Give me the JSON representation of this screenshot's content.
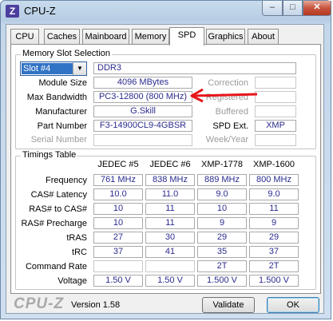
{
  "window": {
    "title": "CPU-Z",
    "icon_text": "Z",
    "min": "–",
    "max": "□",
    "close": "✕"
  },
  "tabs": [
    "CPU",
    "Caches",
    "Mainboard",
    "Memory",
    "SPD",
    "Graphics",
    "About"
  ],
  "active_tab": "SPD",
  "memory_slot": {
    "group_title": "Memory Slot Selection",
    "slot": "Slot #4",
    "type": "DDR3",
    "labels": {
      "module_size": "Module Size",
      "max_bandwidth": "Max Bandwidth",
      "manufacturer": "Manufacturer",
      "part_number": "Part Number",
      "serial_number": "Serial Number",
      "correction": "Correction",
      "registered": "Registered",
      "buffered": "Buffered",
      "spd_ext": "SPD Ext.",
      "week_year": "Week/Year"
    },
    "values": {
      "module_size": "4096 MBytes",
      "max_bandwidth": "PC3-12800 (800 MHz)",
      "manufacturer": "G.Skill",
      "part_number": "F3-14900CL9-4GBSR",
      "serial_number": "",
      "correction": "",
      "registered": "",
      "buffered": "",
      "spd_ext": "XMP",
      "week_year": ""
    }
  },
  "timings": {
    "group_title": "Timings Table",
    "columns": [
      "JEDEC #5",
      "JEDEC #6",
      "XMP-1778",
      "XMP-1600"
    ],
    "rows": [
      {
        "label": "Frequency",
        "values": [
          "761 MHz",
          "838 MHz",
          "889 MHz",
          "800 MHz"
        ]
      },
      {
        "label": "CAS# Latency",
        "values": [
          "10.0",
          "11.0",
          "9.0",
          "9.0"
        ]
      },
      {
        "label": "RAS# to CAS#",
        "values": [
          "10",
          "11",
          "10",
          "11"
        ]
      },
      {
        "label": "RAS# Precharge",
        "values": [
          "10",
          "11",
          "9",
          "9"
        ]
      },
      {
        "label": "tRAS",
        "values": [
          "27",
          "30",
          "29",
          "29"
        ]
      },
      {
        "label": "tRC",
        "values": [
          "37",
          "41",
          "35",
          "37"
        ]
      },
      {
        "label": "Command Rate",
        "values": [
          "",
          "",
          "2T",
          "2T"
        ]
      },
      {
        "label": "Voltage",
        "values": [
          "1.50 V",
          "1.50 V",
          "1.500 V",
          "1.500 V"
        ]
      }
    ]
  },
  "footer": {
    "brand": "CPU-Z",
    "version": "Version 1.58",
    "validate": "Validate",
    "ok": "OK"
  },
  "annotation": {
    "arrow_color": "#e8141a"
  }
}
